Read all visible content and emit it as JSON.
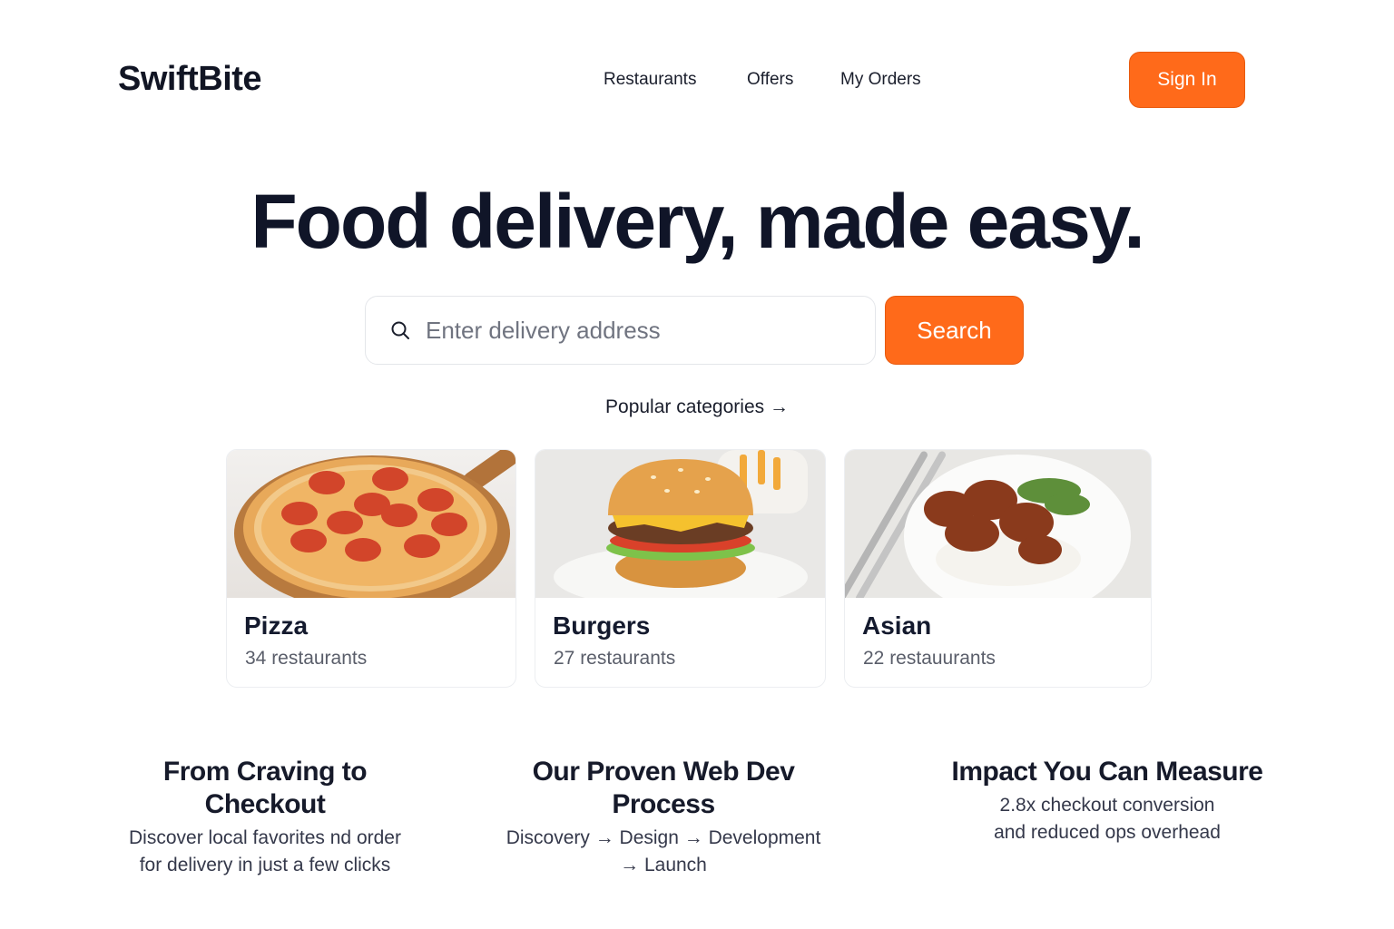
{
  "header": {
    "logo": "SwiftBite",
    "nav": [
      "Restaurants",
      "Offers",
      "My Orders"
    ],
    "signin_label": "Sign In"
  },
  "hero": {
    "title": "Food delivery, made easy."
  },
  "search": {
    "placeholder": "Enter delivery address",
    "button_label": "Search"
  },
  "categories": {
    "heading": "Popular categories →",
    "items": [
      {
        "name": "Pizza",
        "count": "34 restaurants"
      },
      {
        "name": "Burgers",
        "count": "27 restaurants"
      },
      {
        "name": "Asian",
        "count": "22 restauurants"
      }
    ]
  },
  "features": [
    {
      "title": "From Craving to Checkout",
      "text_line1": "Discover local favorites  nd order",
      "text_line2": "for delivery in just a few clicks"
    },
    {
      "title": "Our Proven Web Dev Process",
      "text_line1": "Discovery → Design → Development",
      "text_line2": "→ Launch"
    },
    {
      "title": "Impact You Can Measure",
      "text_line1": "2.8x checkout conversion",
      "text_line2": "and reduced ops overhead"
    }
  ],
  "colors": {
    "accent": "#ff6a1a",
    "text": "#141a2e"
  }
}
